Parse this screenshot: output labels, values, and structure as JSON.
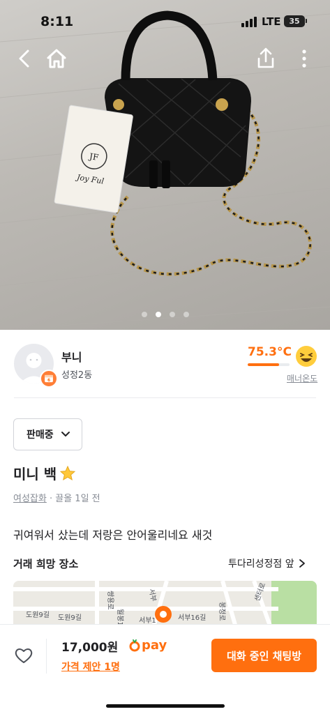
{
  "status_bar": {
    "time": "8:11",
    "network": "LTE",
    "battery": "35"
  },
  "nav": {
    "icons": [
      "back-icon",
      "home-icon",
      "share-icon",
      "more-icon"
    ]
  },
  "gallery": {
    "total": 4,
    "active": 1
  },
  "seller": {
    "name": "부니",
    "region": "성정2동",
    "temperature": "75.3°C",
    "temperature_level": 0.753,
    "manner_label": "매너온도"
  },
  "post": {
    "status": "판매중",
    "title": "미니 백",
    "category": "여성잡화",
    "time": "끌올 1일 전",
    "description": "귀여워서 샀는데 저랑은 안어울리네요 새것"
  },
  "place": {
    "label": "거래 희망 장소",
    "value": "투다리성정점 앞"
  },
  "map": {
    "labels": [
      "도원9길",
      "도원9길",
      "서부16길",
      "서부1",
      "쌍용로",
      "봉정로",
      "월봉1",
      "센터로",
      "서부"
    ]
  },
  "bottom": {
    "price": "17,000원",
    "pay_label": "pay",
    "offer": "가격 제안 1명",
    "chat_button": "대화 중인 채팅방"
  },
  "colors": {
    "accent": "#ff6f0f",
    "text": "#212124",
    "sub": "#868b94"
  }
}
